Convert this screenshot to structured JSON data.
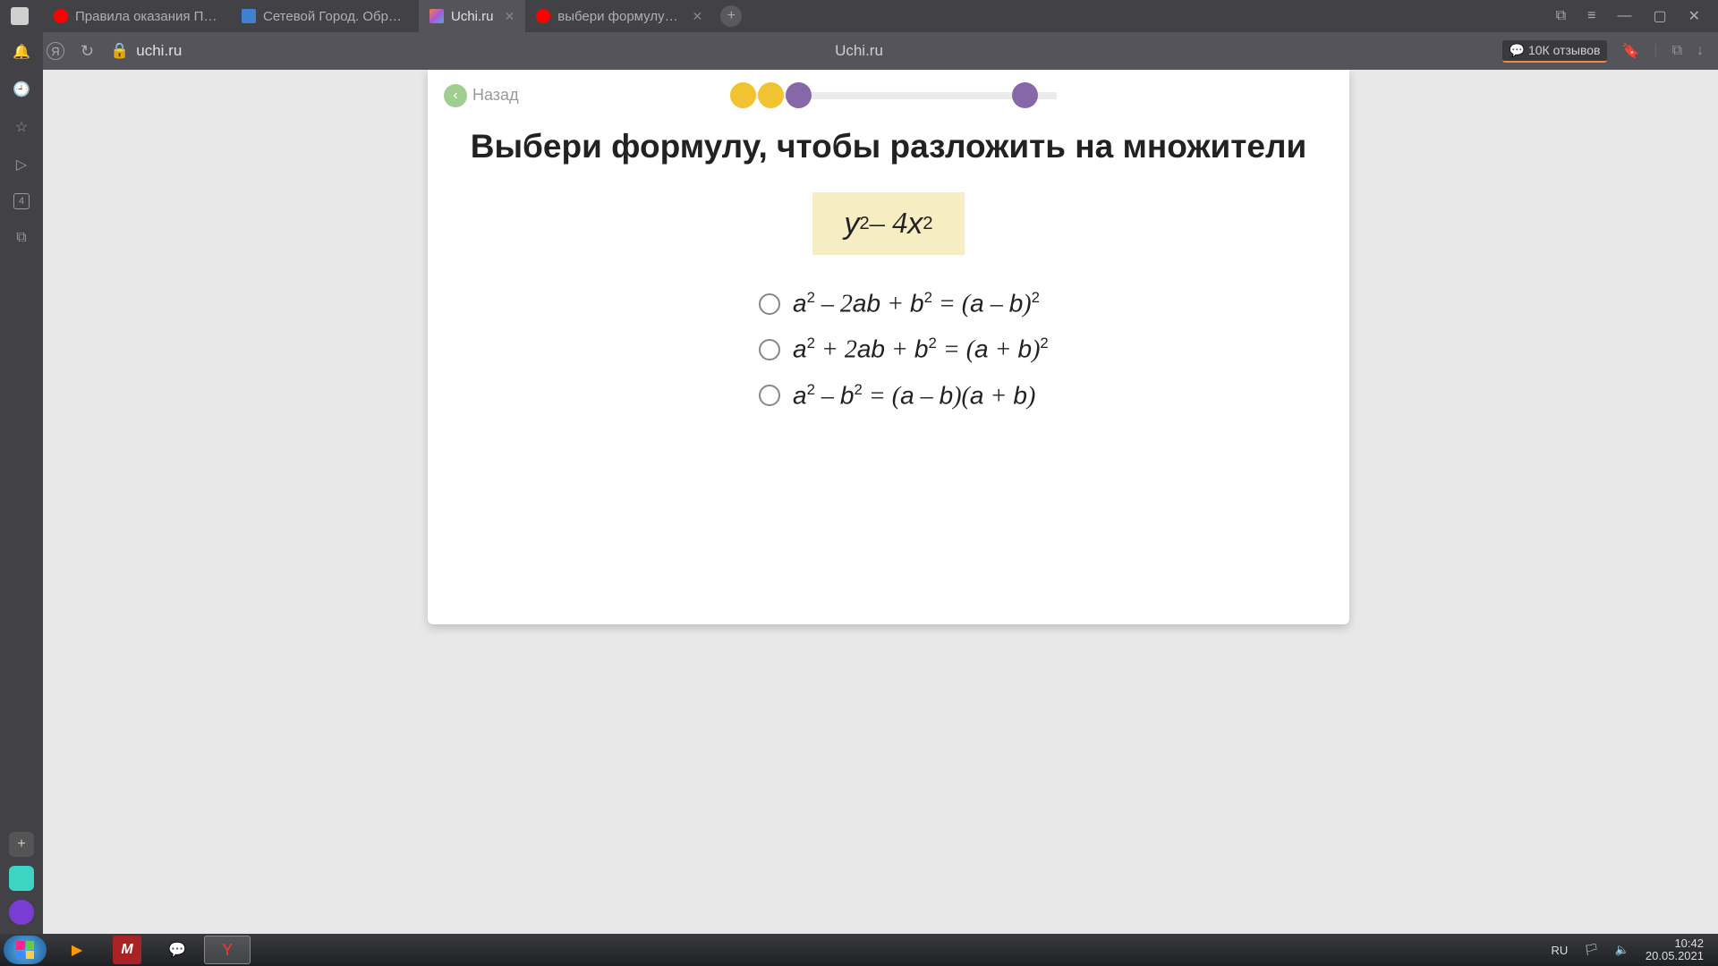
{
  "browser": {
    "tabs": [
      {
        "label": "Правила оказания ПП. —",
        "favicon": "yandex"
      },
      {
        "label": "Сетевой Город. Образова",
        "favicon": "sev"
      },
      {
        "label": "Uchi.ru",
        "favicon": "uchi",
        "active": true
      },
      {
        "label": "выбери формулу чтоб",
        "favicon": "yandex"
      }
    ],
    "address_url": "uchi.ru",
    "address_title": "Uchi.ru",
    "reviews": "10К отзывов"
  },
  "sidebar": {
    "badge_count": "4"
  },
  "lesson": {
    "back_label": "Назад",
    "title": "Выбери формулу, чтобы разложить на множители",
    "expression_html": "<i>y</i><sup>2</sup> – 4<i>x</i><sup>2</sup>",
    "options": [
      {
        "html": "<i>a</i><sup>2</sup> – 2<i>ab</i> + <i>b</i><sup>2</sup> = (<i>a</i> – <i>b</i>)<sup>2</sup>"
      },
      {
        "html": "<i>a</i><sup>2</sup> + 2<i>ab</i> + <i>b</i><sup>2</sup> = (<i>a</i> + <i>b</i>)<sup>2</sup>"
      },
      {
        "html": "<i>a</i><sup>2</sup> – <i>b</i><sup>2</sup> = (<i>a</i> – <i>b</i>)(<i>a</i> + <i>b</i>)"
      }
    ],
    "progress": {
      "dots": [
        "yellow",
        "yellow",
        "purple",
        "far-purple"
      ]
    }
  },
  "taskbar": {
    "lang": "RU",
    "time": "10:42",
    "date": "20.05.2021"
  },
  "colors": {
    "dot_yellow": "#f2c331",
    "dot_purple": "#8668a8",
    "expression_bg": "#f7edc3",
    "back_btn": "#a0ce8e"
  }
}
